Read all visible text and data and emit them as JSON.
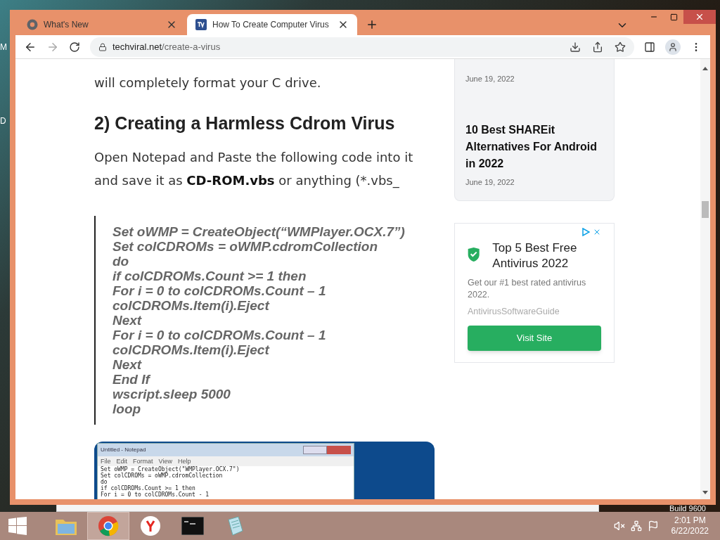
{
  "desktop": {
    "edge_labels": [
      "M",
      "D"
    ],
    "build_text": "Build 9600"
  },
  "browser": {
    "tabs": [
      {
        "title": "What's New",
        "kind": "chrome",
        "selected": false
      },
      {
        "title": "How To Create Computer Virus",
        "kind": "site",
        "selected": true
      }
    ],
    "url": {
      "host": "techviral.net",
      "path": "/create-a-virus"
    }
  },
  "article": {
    "paragraph_end": "will completely format your C drive.",
    "heading": "2) Creating a Harmless Cdrom Virus",
    "instruction": "Open Notepad and Paste the following code into it and save it as **CD-ROM.vbs** or anything (*.vbs_",
    "code_lines": [
      "Set oWMP = CreateObject(“WMPlayer.OCX.7”)",
      "Set colCDROMs = oWMP.cdromCollection",
      "do",
      "if colCDROMs.Count >= 1 then",
      "For i = 0 to colCDROMs.Count – 1",
      "colCDROMs.Item(i).Eject",
      "Next",
      "For i = 0 to colCDROMs.Count – 1",
      "colCDROMs.Item(i).Eject",
      "Next",
      "End If",
      "wscript.sleep 5000",
      "loop"
    ],
    "screenshot": {
      "title": "Untitled - Notepad",
      "menu": [
        "File",
        "Edit",
        "Format",
        "View",
        "Help"
      ],
      "lines": [
        "Set oWMP = CreateObject(\"WMPlayer.OCX.7\")",
        "Set colCDROMs = oWMP.cdromCollection",
        "do",
        "if colCDROMs.Count >= 1 then",
        "For i = 0 to colCDROMs.Count - 1"
      ]
    }
  },
  "sidebar": {
    "posts": [
      {
        "date": "June 19, 2022"
      },
      {
        "title": "10 Best SHAREit Alternatives For Android in 2022",
        "date": "June 19, 2022"
      }
    ],
    "ad": {
      "title": "Top 5 Best Free Antivirus 2022",
      "body": "Get our #1 best rated antivirus 2022.",
      "source": "AntivirusSoftwareGuide",
      "button": "Visit Site"
    }
  },
  "taskbar": {
    "apps": [
      {
        "kind": "explorer",
        "selected": false
      },
      {
        "kind": "chrome",
        "selected": true
      },
      {
        "kind": "yandex",
        "selected": false
      },
      {
        "kind": "cmd",
        "selected": false
      },
      {
        "kind": "notepad",
        "selected": false
      }
    ],
    "time": "2:01 PM",
    "date": "6/22/2022"
  }
}
